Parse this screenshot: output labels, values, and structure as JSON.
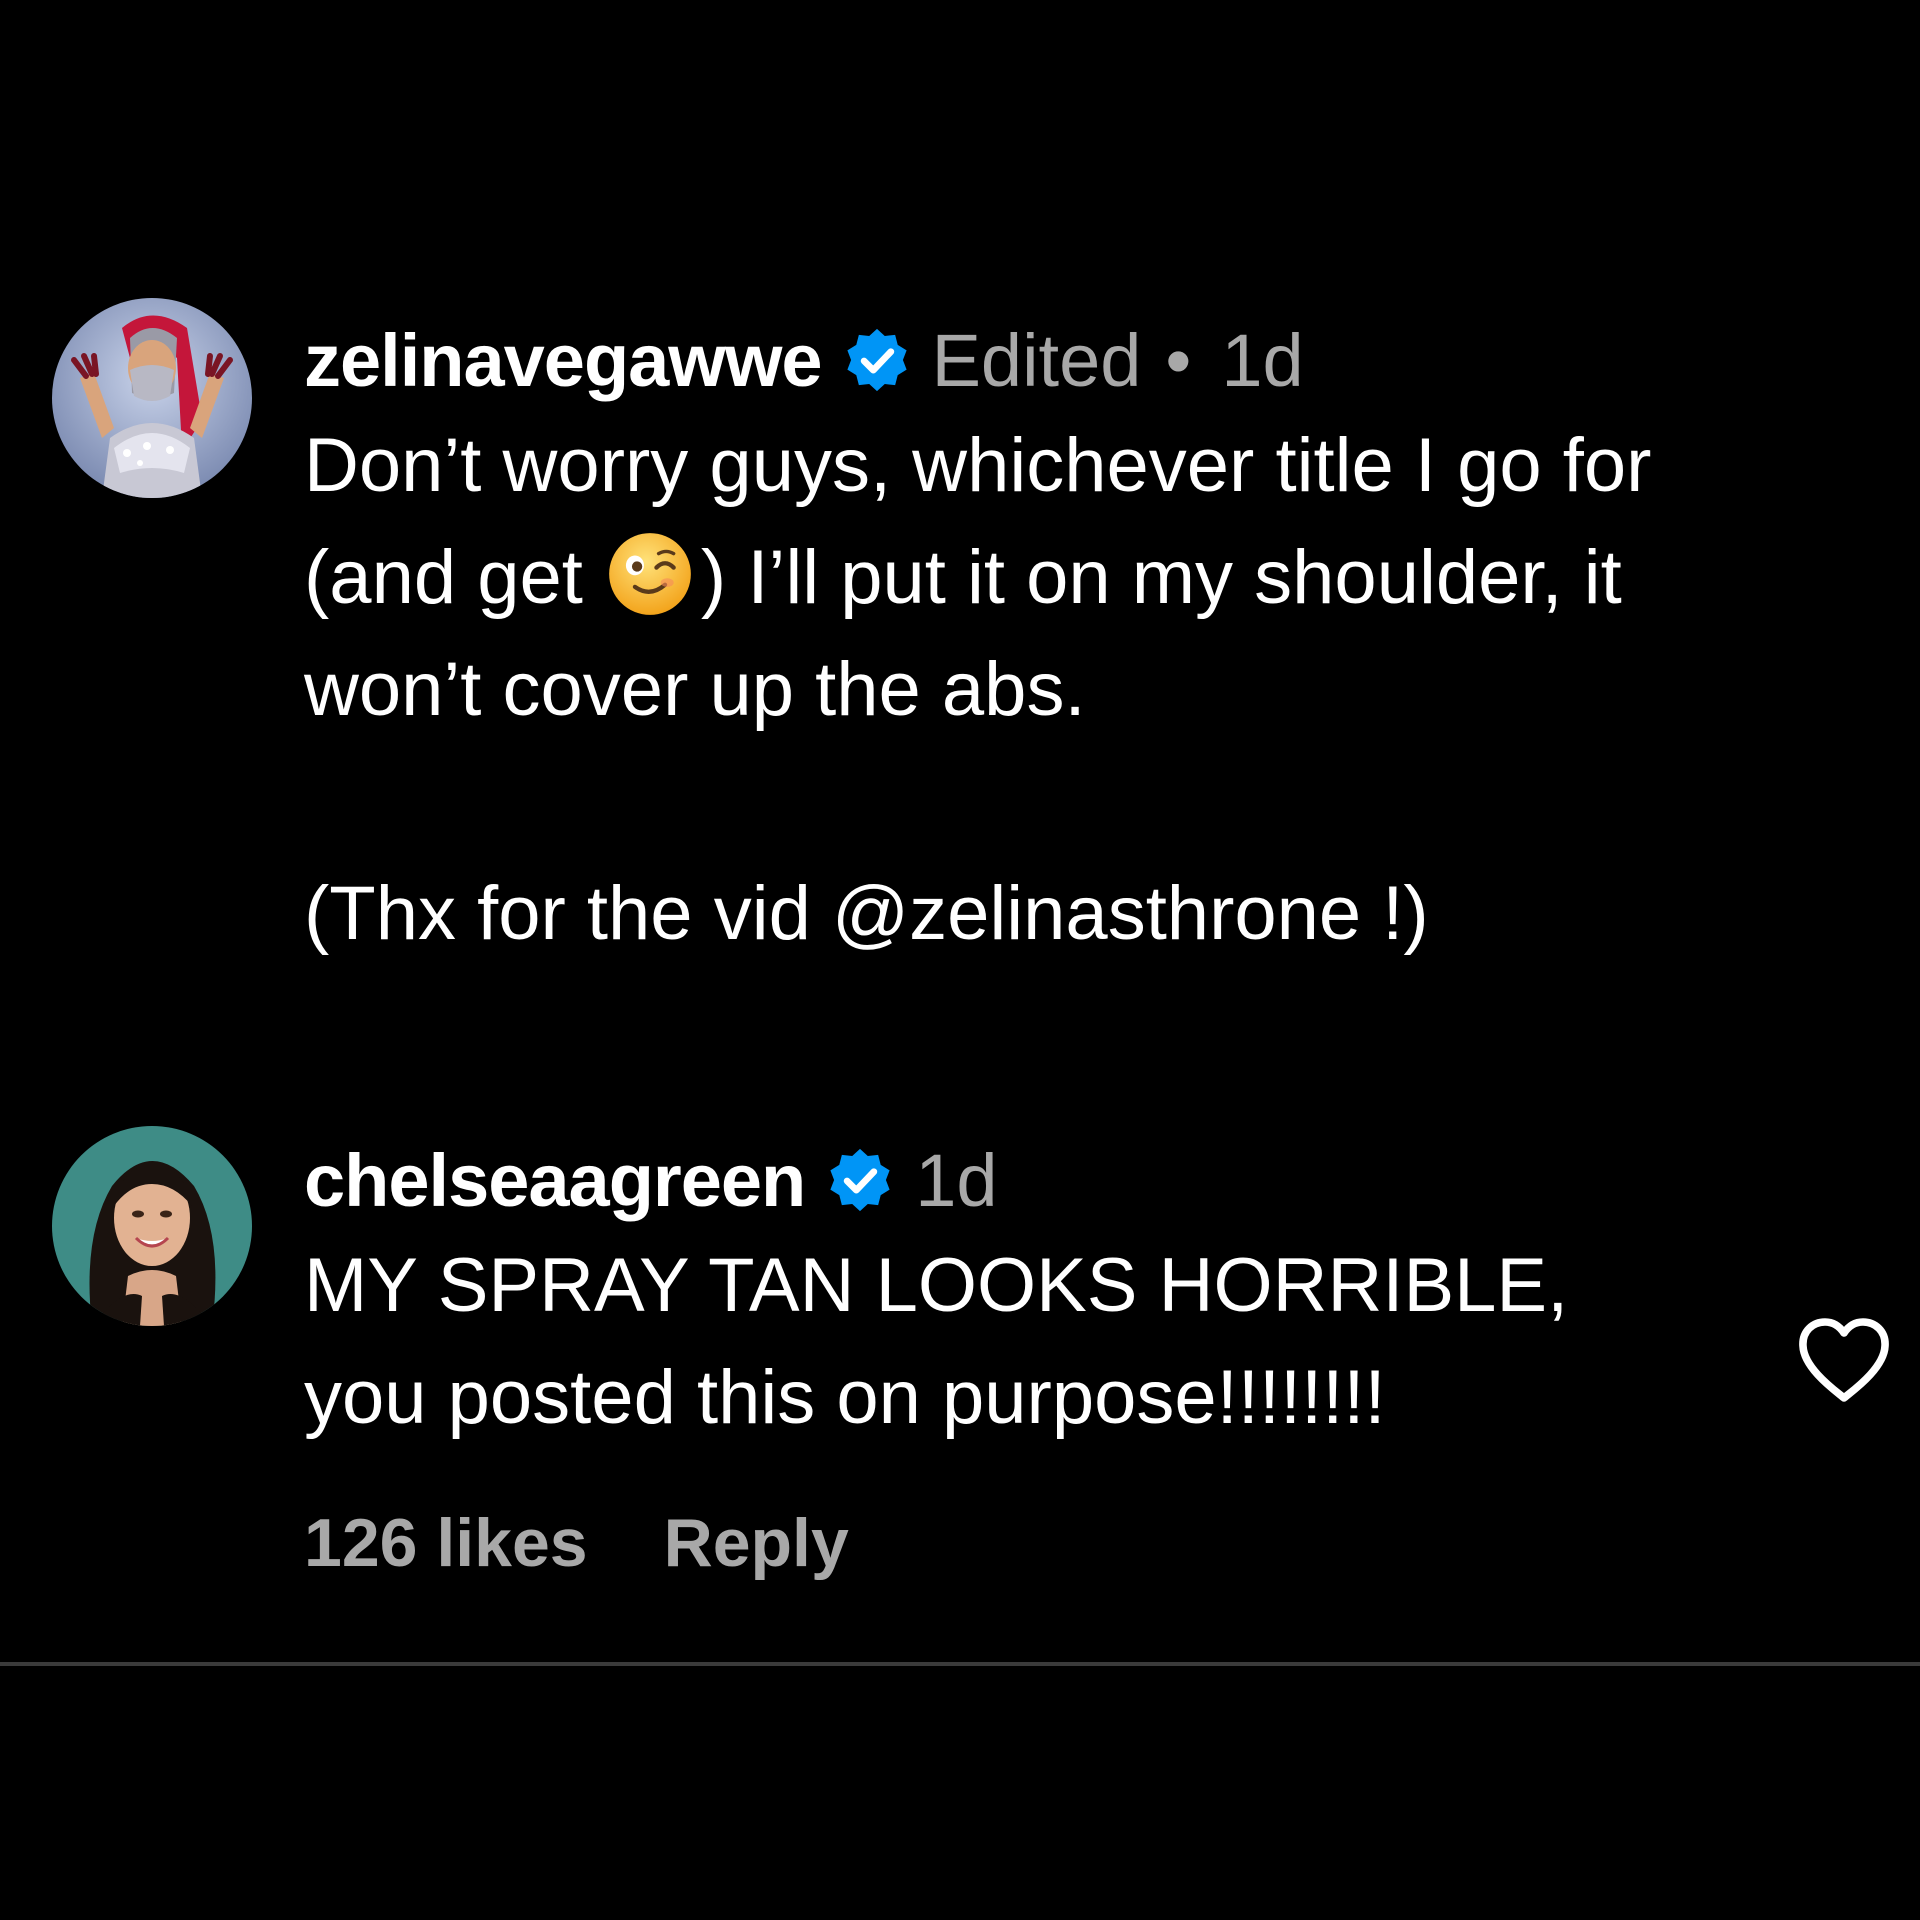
{
  "comments": [
    {
      "username": "zelinavegawwe",
      "verified": true,
      "edited_label": "Edited",
      "separator": "•",
      "time": "1d",
      "text_line1": "Don’t worry guys, whichever title I go for",
      "text_line2_start": "(and get",
      "emoji": "winking-face",
      "text_line2_end": ") I’ll put it on my shoulder, it",
      "text_line3": "won’t cover up the abs.",
      "text_line5_start": "(Thx for the vid ",
      "mention": "@zelinasthrone",
      "text_line5_end": " !)"
    },
    {
      "username": "chelseaagreen",
      "verified": true,
      "time": "1d",
      "text_line1": "MY SPRAY TAN LOOKS HORRIBLE,",
      "text_line2": "you posted this on purpose!!!!!!!!",
      "likes": "126 likes",
      "reply_label": "Reply"
    }
  ],
  "icons": {
    "verified": "verified-badge-icon",
    "like": "heart-icon"
  },
  "colors": {
    "background": "#000000",
    "primary_text": "#ffffff",
    "secondary_text": "#a8a8a8",
    "verified_blue": "#0095f6",
    "divider": "#3a3a3a"
  }
}
